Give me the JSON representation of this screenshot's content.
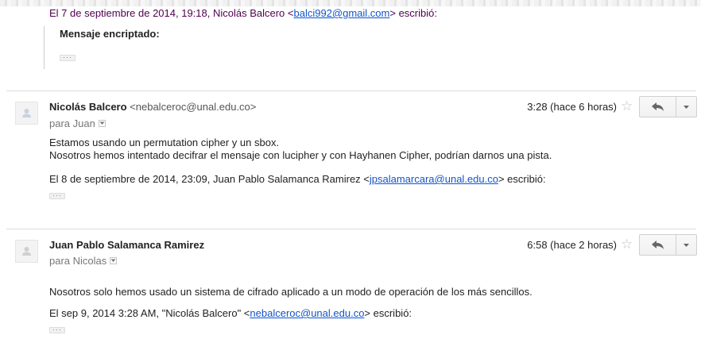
{
  "top_quote": {
    "prefix": "El 7 de septiembre de 2014, 19:18, Nicolás Balcero <",
    "email": "balci992@gmail.com",
    "suffix": "> escribió:",
    "quoted_heading": "Mensaje encriptado:",
    "ellipsis": "···"
  },
  "messages": [
    {
      "sender": "Nicolás Balcero",
      "email": "<nebalceroc@unal.edu.co>",
      "to": "para Juan",
      "time": "3:28 (hace 6 horas)",
      "body_lines": [
        "Estamos usando un permutation cipher y un sbox.",
        "Nosotros hemos intentado decifrar el mensaje con lucipher y con Hayhanen Cipher, podrían darnos una pista."
      ],
      "quote_prefix": "El 8 de septiembre de 2014, 23:09, Juan Pablo Salamanca Ramirez <",
      "quote_email": "jpsalamarcara@unal.edu.co",
      "quote_suffix": "> escribió:",
      "ellipsis": "···"
    },
    {
      "sender": "Juan Pablo Salamanca Ramirez",
      "email": "",
      "to": "para Nicolas",
      "time": "6:58 (hace 2 horas)",
      "body_lines": [
        "Nosotros solo hemos usado un sistema de cifrado aplicado a un modo de operación de los más sencillos."
      ],
      "quote_prefix": "El sep 9, 2014 3:28 AM, \"Nicolás Balcero\" <",
      "quote_email": "nebalceroc@unal.edu.co",
      "quote_suffix": "> escribió:",
      "ellipsis": "···"
    }
  ],
  "colors": {
    "quote_header": "#500050",
    "link": "#1155cc",
    "divider": "#dcdcdc"
  },
  "icons": {
    "avatar": "person-silhouette-icon",
    "star": "star-icon",
    "reply": "reply-arrow-icon",
    "more": "dropdown-caret-icon"
  }
}
